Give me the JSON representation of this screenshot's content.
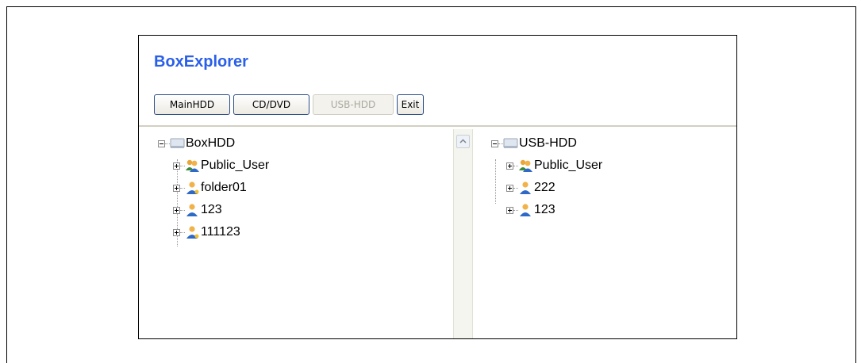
{
  "app": {
    "title": "BoxExplorer"
  },
  "toolbar": {
    "main_hdd": "MainHDD",
    "cd_dvd": "CD/DVD",
    "usb_hdd": "USB-HDD",
    "exit": "Exit"
  },
  "left_tree": {
    "root": "BoxHDD",
    "items": [
      "Public_User",
      "folder01",
      "123",
      "111123"
    ]
  },
  "right_tree": {
    "root": "USB-HDD",
    "items": [
      "Public_User",
      "222",
      "123"
    ]
  }
}
